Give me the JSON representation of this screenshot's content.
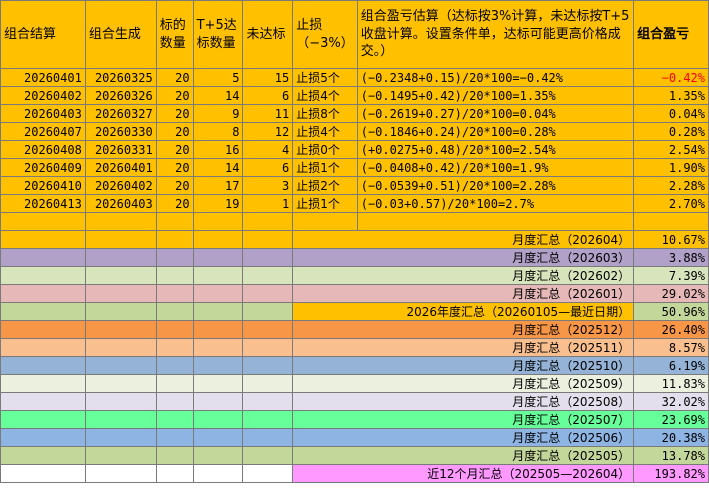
{
  "headers": [
    "组合结算",
    "组合生成",
    "标的数量",
    "T+5达标数量",
    "未达标",
    "止损（−3%）",
    "组合盈亏估算（达标按3%计算，未达标按T+5收盘计算。设置条件单，达标可能更高价格成交。）",
    "组合盈亏"
  ],
  "colors": {
    "orange": "#ffc000",
    "purple": "#b1a0c7",
    "light_green": "#d8e4bc",
    "pink": "#e6b8b7",
    "sage": "#c4d79b",
    "dark_orange": "#f79646",
    "peach": "#fabf8f",
    "blue": "#95b3d7",
    "pale_yellow": "#ebf1de",
    "lavender": "#e4dfec",
    "green": "#66ff99",
    "light_blue": "#8db4e2",
    "magenta": "#ff99ff",
    "white": "#ffffff"
  },
  "rows": [
    {
      "settle": "20260401",
      "gen": "20260325",
      "count": "20",
      "hit": "5",
      "miss": "15",
      "stop": "止损5个",
      "calc": "(−0.2348+0.15)/20*100=−0.42%",
      "pnl": "−0.42%",
      "neg": true
    },
    {
      "settle": "20260402",
      "gen": "20260326",
      "count": "20",
      "hit": "14",
      "miss": "6",
      "stop": "止损4个",
      "calc": "(−0.1495+0.42)/20*100=1.35%",
      "pnl": "1.35%"
    },
    {
      "settle": "20260403",
      "gen": "20260327",
      "count": "20",
      "hit": "9",
      "miss": "11",
      "stop": "止损8个",
      "calc": "(−0.2619+0.27)/20*100=0.04%",
      "pnl": "0.04%"
    },
    {
      "settle": "20260407",
      "gen": "20260330",
      "count": "20",
      "hit": "8",
      "miss": "12",
      "stop": "止损4个",
      "calc": "(−0.1846+0.24)/20*100=0.28%",
      "pnl": "0.28%"
    },
    {
      "settle": "20260408",
      "gen": "20260331",
      "count": "20",
      "hit": "16",
      "miss": "4",
      "stop": "止损0个",
      "calc": "(+0.0275+0.48)/20*100=2.54%",
      "pnl": "2.54%"
    },
    {
      "settle": "20260409",
      "gen": "20260401",
      "count": "20",
      "hit": "14",
      "miss": "6",
      "stop": "止损1个",
      "calc": "(−0.0408+0.42)/20*100=1.9%",
      "pnl": "1.90%"
    },
    {
      "settle": "20260410",
      "gen": "20260402",
      "count": "20",
      "hit": "17",
      "miss": "3",
      "stop": "止损2个",
      "calc": "(−0.0539+0.51)/20*100=2.28%",
      "pnl": "2.28%"
    },
    {
      "settle": "20260413",
      "gen": "20260403",
      "count": "20",
      "hit": "19",
      "miss": "1",
      "stop": "止损1个",
      "calc": "(−0.03+0.57)/20*100=2.7%",
      "pnl": "2.70%"
    }
  ],
  "summaries": [
    {
      "label": "月度汇总（202604）",
      "value": "10.67%",
      "color": "orange",
      "span": 5
    },
    {
      "label": "月度汇总（202603）",
      "value": "3.88%",
      "color": "purple",
      "span": 5
    },
    {
      "label": "月度汇总（202602）",
      "value": "7.39%",
      "color": "light_green",
      "span": 5
    },
    {
      "label": "月度汇总（202601）",
      "value": "29.02%",
      "color": "pink",
      "span": 5
    },
    {
      "label": "2026年度汇总（20260105—最近日期）",
      "value": "50.96%",
      "color": "sage",
      "label_color": "orange",
      "span": 5
    },
    {
      "label": "月度汇总（202512）",
      "value": "26.40%",
      "color": "dark_orange",
      "span": 5
    },
    {
      "label": "月度汇总（202511）",
      "value": "8.57%",
      "color": "peach",
      "span": 5
    },
    {
      "label": "月度汇总（202510）",
      "value": "6.19%",
      "color": "blue",
      "span": 5
    },
    {
      "label": "月度汇总（202509）",
      "value": "11.83%",
      "color": "pale_yellow",
      "span": 5
    },
    {
      "label": "月度汇总（202508）",
      "value": "32.02%",
      "color": "lavender",
      "span": 5
    },
    {
      "label": "月度汇总（202507）",
      "value": "23.69%",
      "color": "green",
      "span": 5
    },
    {
      "label": "月度汇总（202506）",
      "value": "20.38%",
      "color": "light_blue",
      "span": 5
    },
    {
      "label": "月度汇总（202505）",
      "value": "13.78%",
      "color": "sage",
      "span": 5
    },
    {
      "label": "近12个月汇总（202505—202604）",
      "value": "193.82%",
      "color": "white",
      "label_color": "magenta",
      "value_color": "magenta",
      "span": 5
    }
  ]
}
